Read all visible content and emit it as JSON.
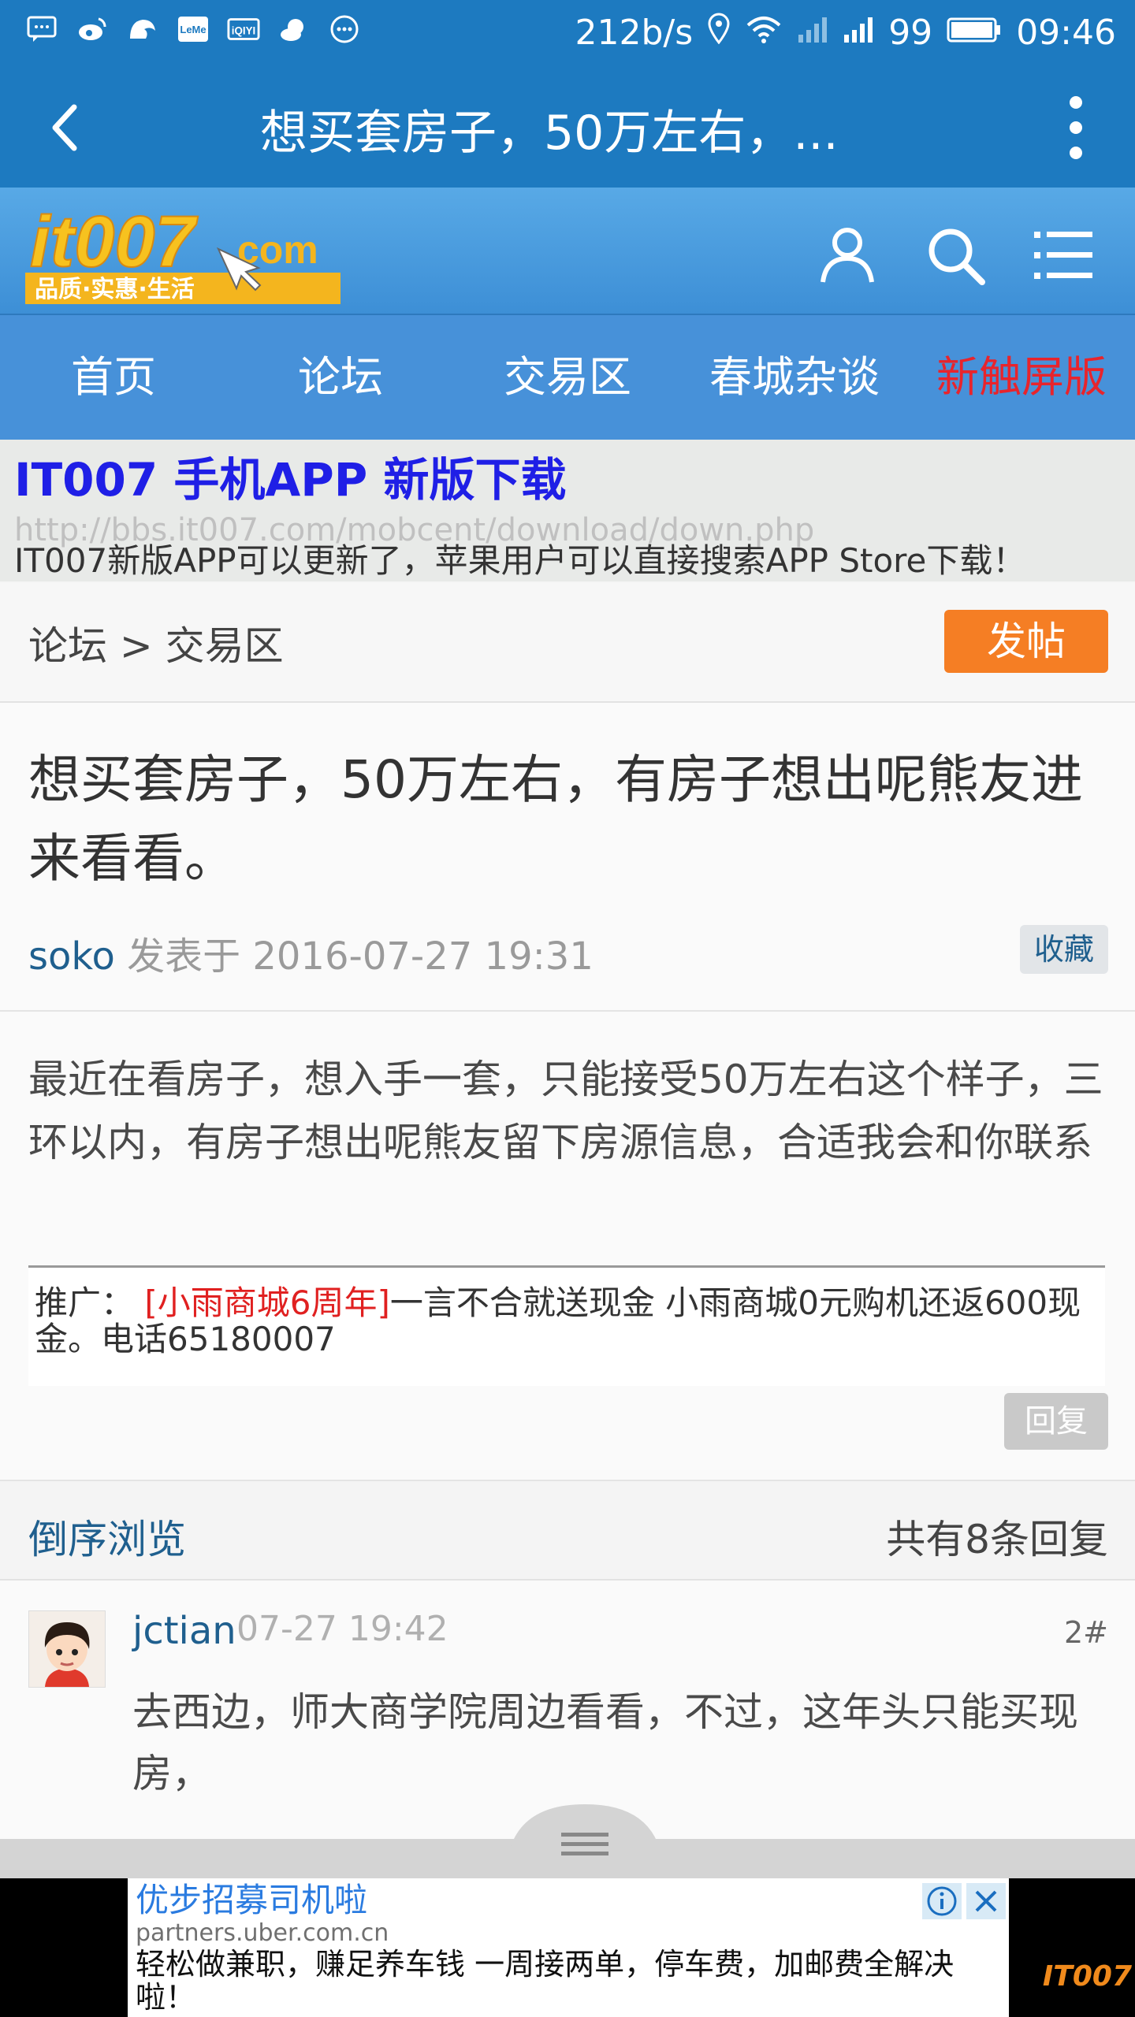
{
  "statusbar": {
    "speed": "212b/s",
    "battery": "99",
    "time": "09:46"
  },
  "appbar": {
    "title": "想买套房子，50万左右，..."
  },
  "site": {
    "logo_text": "it007",
    "logo_suffix": ".com",
    "logo_slogan": "品质·实惠·生活"
  },
  "nav": {
    "items": [
      "首页",
      "论坛",
      "交易区",
      "春城杂谈",
      "新触屏版"
    ]
  },
  "banner": {
    "title": "IT007 手机APP 新版下载",
    "url": "http://bbs.it007.com/mobcent/download/down.php",
    "desc": "IT007新版APP可以更新了，苹果用户可以直接搜索APP Store下载！"
  },
  "breadcrumb": {
    "text": "论坛 > 交易区",
    "post_label": "发帖"
  },
  "thread": {
    "title": "想买套房子，50万左右，有房子想出呢熊友进来看看。",
    "author": "soko",
    "meta": " 发表于 2016-07-27 19:31",
    "fav_label": "收藏",
    "content": "最近在看房子，想入手一套，只能接受50万左右这个样子，三环以内，有房子想出呢熊友留下房源信息，合适我会和你联系",
    "promo_prefix": "推广：",
    "promo_tag": "[小雨商城6周年]",
    "promo_text": "一言不合就送现金 小雨商城0元购机还返600现金。电话65180007",
    "reply_label": "回复"
  },
  "replies_bar": {
    "sort_label": "倒序浏览",
    "count_label": "共有8条回复"
  },
  "replies": [
    {
      "author": "jctian",
      "time": "07-27 19:42",
      "floor": "2#",
      "content": "去西边，师大商学院周边看看，不过，这年头只能买现房，"
    }
  ],
  "ad": {
    "title": "优步招募司机啦",
    "domain": "partners.uber.com.cn",
    "desc": "轻松做兼职，赚足养车钱 一周接两单，停车费，加邮费全解决啦！",
    "watermark": "IT007"
  }
}
